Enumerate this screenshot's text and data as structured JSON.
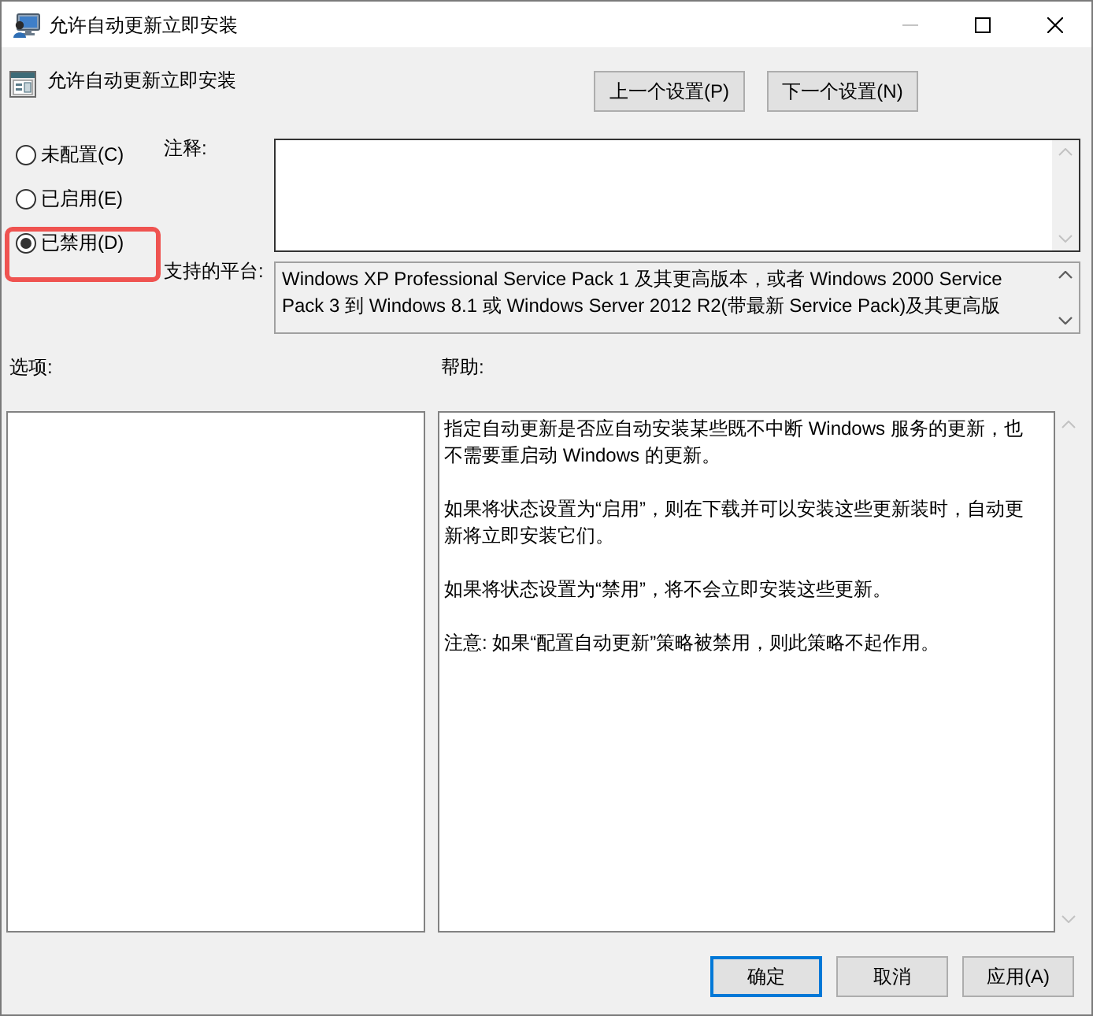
{
  "window": {
    "title": "允许自动更新立即安装",
    "controls": [
      {
        "kind": "minimize",
        "disabled": true
      },
      {
        "kind": "maximize",
        "disabled": false
      },
      {
        "kind": "close",
        "disabled": false
      }
    ]
  },
  "setting": {
    "title": "允许自动更新立即安装"
  },
  "nav_buttons": [
    {
      "label": "上一个设置(P)"
    },
    {
      "label": "下一个设置(N)"
    }
  ],
  "radio_options": [
    {
      "label": "未配置(C)",
      "selected": false,
      "highlighted": false
    },
    {
      "label": "已启用(E)",
      "selected": false,
      "highlighted": false
    },
    {
      "label": "已禁用(D)",
      "selected": true,
      "highlighted": true
    }
  ],
  "comment": {
    "label": "注释:"
  },
  "platform": {
    "label": "支持的平台:",
    "value": "Windows XP Professional Service Pack 1 及其更高版本，或者 Windows 2000 Service Pack 3 到 Windows 8.1 或 Windows Server 2012 R2(带最新 Service Pack)及其更高版"
  },
  "options_panel": {
    "label": "选项:"
  },
  "help": {
    "label": "帮助:",
    "paragraphs": [
      "指定自动更新是否应自动安装某些既不中断 Windows 服务的更新，也不需要重启动 Windows 的更新。",
      "如果将状态设置为“启用”，则在下载并可以安装这些更新装时，自动更新将立即安装它们。",
      "如果将状态设置为“禁用”，将不会立即安装这些更新。",
      "注意: 如果“配置自动更新”策略被禁用，则此策略不起作用。"
    ]
  },
  "buttons": [
    {
      "label": "确定",
      "default": true
    },
    {
      "label": "取消",
      "default": false
    },
    {
      "label": "应用(A)",
      "default": false
    }
  ]
}
